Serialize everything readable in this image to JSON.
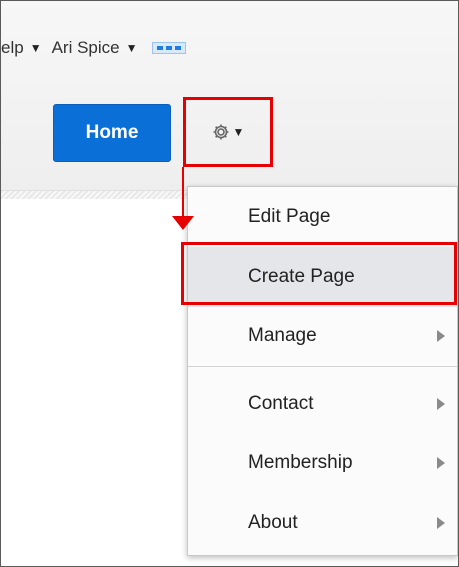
{
  "topbar": {
    "help_label": "elp",
    "user_label": "Ari Spice"
  },
  "nav": {
    "home_label": "Home"
  },
  "menu": {
    "items": [
      {
        "label": "Edit Page",
        "has_submenu": false
      },
      {
        "label": "Create Page",
        "has_submenu": false
      },
      {
        "label": "Manage",
        "has_submenu": true
      },
      {
        "label": "Contact",
        "has_submenu": true
      },
      {
        "label": "Membership",
        "has_submenu": true
      },
      {
        "label": "About",
        "has_submenu": true
      }
    ]
  },
  "colors": {
    "accent": "#0a6fd6",
    "highlight": "#e60000",
    "selected_bg": "#e4e6ea"
  },
  "icons": [
    "caret-down-icon",
    "more-icon",
    "gear-icon",
    "submenu-arrow-icon"
  ]
}
